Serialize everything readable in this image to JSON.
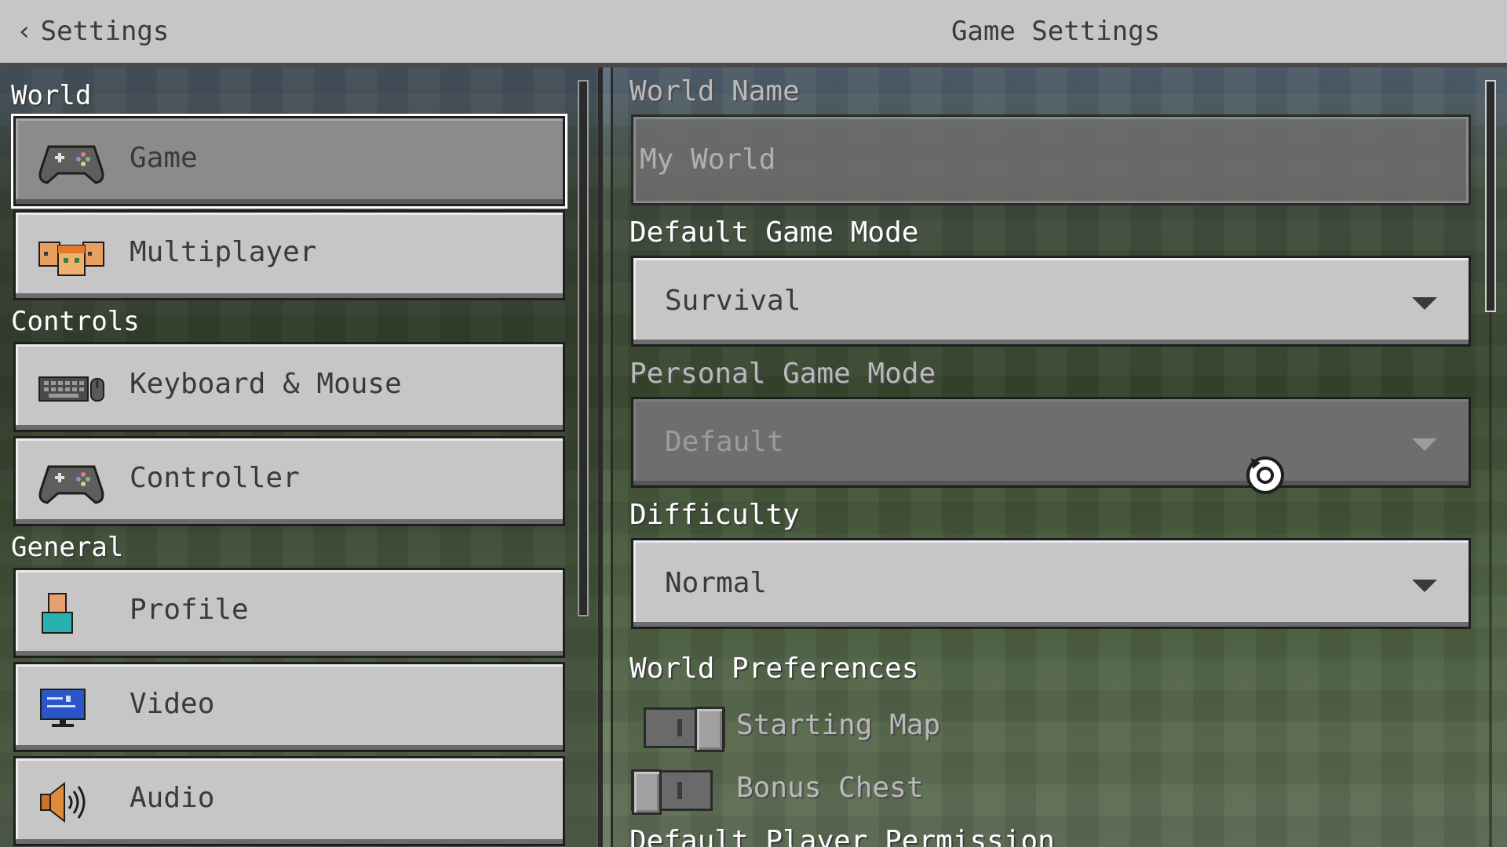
{
  "header": {
    "back_label": "Settings",
    "title": "Game Settings"
  },
  "sidebar": {
    "sections": [
      {
        "label": "World"
      },
      {
        "label": "Controls"
      },
      {
        "label": "General"
      }
    ],
    "items": [
      {
        "label": "Game",
        "icon": "controller-icon",
        "selected": true
      },
      {
        "label": "Multiplayer",
        "icon": "multiplayer-icon"
      },
      {
        "label": "Keyboard & Mouse",
        "icon": "keyboard-mouse-icon"
      },
      {
        "label": "Controller",
        "icon": "controller-icon"
      },
      {
        "label": "Profile",
        "icon": "profile-icon"
      },
      {
        "label": "Video",
        "icon": "monitor-icon"
      },
      {
        "label": "Audio",
        "icon": "speaker-icon"
      }
    ]
  },
  "main": {
    "world_name": {
      "label": "World Name",
      "value": "My World"
    },
    "default_game_mode": {
      "label": "Default Game Mode",
      "value": "Survival"
    },
    "personal_game_mode": {
      "label": "Personal Game Mode",
      "value": "Default"
    },
    "difficulty": {
      "label": "Difficulty",
      "value": "Normal"
    },
    "world_preferences": {
      "heading": "World Preferences",
      "starting_map": {
        "label": "Starting Map",
        "on": true
      },
      "bonus_chest": {
        "label": "Bonus Chest",
        "on": false
      }
    },
    "default_player_permission": {
      "label": "Default Player Permission"
    }
  },
  "colors": {
    "button_face": "#c6c6c6",
    "button_selected": "#8b8b8b",
    "disabled_face": "#6e6e6e",
    "label_white": "#ffffff",
    "label_dim": "#b9b9b9",
    "text_dark": "#3a3a3a"
  }
}
